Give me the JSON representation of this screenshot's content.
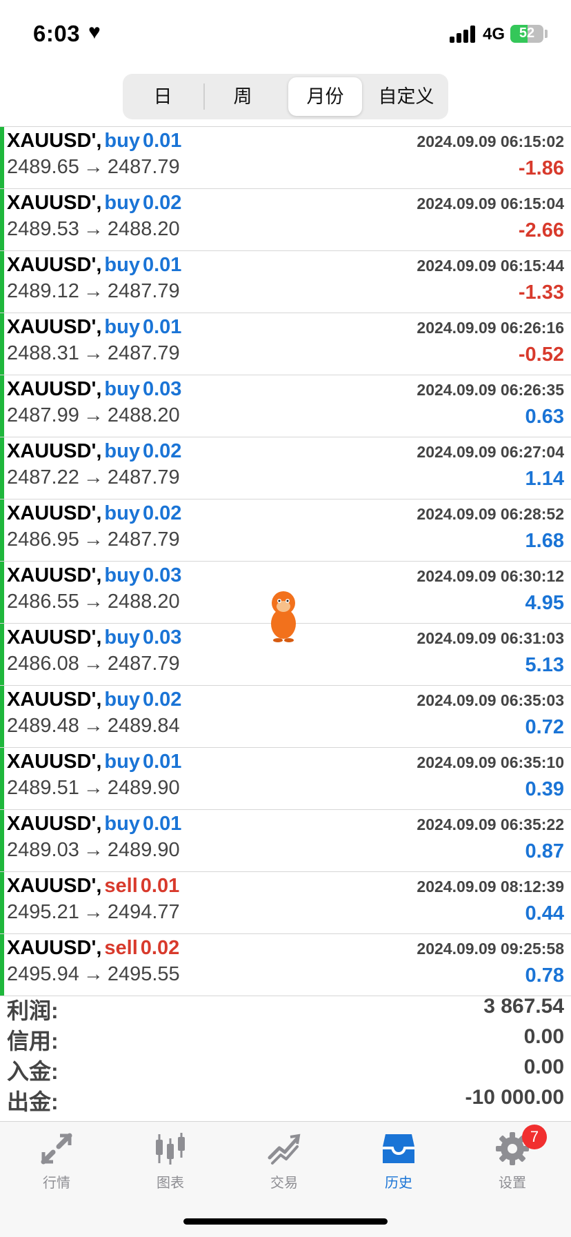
{
  "status_bar": {
    "time": "6:03",
    "network": "4G",
    "battery": "52",
    "battery_level_percent": 52
  },
  "segments": [
    {
      "label": "日",
      "active": false
    },
    {
      "label": "周",
      "active": false
    },
    {
      "label": "月份",
      "active": true
    },
    {
      "label": "自定义",
      "active": false
    }
  ],
  "colors": {
    "buy": "#1a74d6",
    "sell": "#d83a2c",
    "positive": "#1a74d6",
    "negative": "#d83a2c",
    "row_bar": "#1fb73c",
    "active_tab": "#1a74d6",
    "badge": "#f12f2f"
  },
  "trades": [
    {
      "symbol": "XAUUSD',",
      "side": "buy",
      "lot": "0.01",
      "open": "2489.65",
      "arrow": "→",
      "close": "2487.79",
      "date": "2024.09.09 06:15:02",
      "profit": "-1.86"
    },
    {
      "symbol": "XAUUSD',",
      "side": "buy",
      "lot": "0.02",
      "open": "2489.53",
      "arrow": "→",
      "close": "2488.20",
      "date": "2024.09.09 06:15:04",
      "profit": "-2.66"
    },
    {
      "symbol": "XAUUSD',",
      "side": "buy",
      "lot": "0.01",
      "open": "2489.12",
      "arrow": "→",
      "close": "2487.79",
      "date": "2024.09.09 06:15:44",
      "profit": "-1.33"
    },
    {
      "symbol": "XAUUSD',",
      "side": "buy",
      "lot": "0.01",
      "open": "2488.31",
      "arrow": "→",
      "close": "2487.79",
      "date": "2024.09.09 06:26:16",
      "profit": "-0.52"
    },
    {
      "symbol": "XAUUSD',",
      "side": "buy",
      "lot": "0.03",
      "open": "2487.99",
      "arrow": "→",
      "close": "2488.20",
      "date": "2024.09.09 06:26:35",
      "profit": "0.63"
    },
    {
      "symbol": "XAUUSD',",
      "side": "buy",
      "lot": "0.02",
      "open": "2487.22",
      "arrow": "→",
      "close": "2487.79",
      "date": "2024.09.09 06:27:04",
      "profit": "1.14"
    },
    {
      "symbol": "XAUUSD',",
      "side": "buy",
      "lot": "0.02",
      "open": "2486.95",
      "arrow": "→",
      "close": "2487.79",
      "date": "2024.09.09 06:28:52",
      "profit": "1.68"
    },
    {
      "symbol": "XAUUSD',",
      "side": "buy",
      "lot": "0.03",
      "open": "2486.55",
      "arrow": "→",
      "close": "2488.20",
      "date": "2024.09.09 06:30:12",
      "profit": "4.95"
    },
    {
      "symbol": "XAUUSD',",
      "side": "buy",
      "lot": "0.03",
      "open": "2486.08",
      "arrow": "→",
      "close": "2487.79",
      "date": "2024.09.09 06:31:03",
      "profit": "5.13"
    },
    {
      "symbol": "XAUUSD',",
      "side": "buy",
      "lot": "0.02",
      "open": "2489.48",
      "arrow": "→",
      "close": "2489.84",
      "date": "2024.09.09 06:35:03",
      "profit": "0.72"
    },
    {
      "symbol": "XAUUSD',",
      "side": "buy",
      "lot": "0.01",
      "open": "2489.51",
      "arrow": "→",
      "close": "2489.90",
      "date": "2024.09.09 06:35:10",
      "profit": "0.39"
    },
    {
      "symbol": "XAUUSD',",
      "side": "buy",
      "lot": "0.01",
      "open": "2489.03",
      "arrow": "→",
      "close": "2489.90",
      "date": "2024.09.09 06:35:22",
      "profit": "0.87"
    },
    {
      "symbol": "XAUUSD',",
      "side": "sell",
      "lot": "0.01",
      "open": "2495.21",
      "arrow": "→",
      "close": "2494.77",
      "date": "2024.09.09 08:12:39",
      "profit": "0.44"
    },
    {
      "symbol": "XAUUSD',",
      "side": "sell",
      "lot": "0.02",
      "open": "2495.94",
      "arrow": "→",
      "close": "2495.55",
      "date": "2024.09.09 09:25:58",
      "profit": "0.78"
    }
  ],
  "summary": [
    {
      "label": "利润:",
      "value": "3 867.54"
    },
    {
      "label": "信用:",
      "value": "0.00"
    },
    {
      "label": "入金:",
      "value": "0.00"
    },
    {
      "label": "出金:",
      "value": "-10 000.00"
    }
  ],
  "tabs": [
    {
      "label": "行情",
      "icon": "quotes-arrows-icon",
      "active": false
    },
    {
      "label": "图表",
      "icon": "candlestick-chart-icon",
      "active": false
    },
    {
      "label": "交易",
      "icon": "trade-trend-icon",
      "active": false
    },
    {
      "label": "历史",
      "icon": "history-inbox-icon",
      "active": true
    },
    {
      "label": "设置",
      "icon": "gear-icon",
      "active": false
    }
  ],
  "settings_badge": "7"
}
